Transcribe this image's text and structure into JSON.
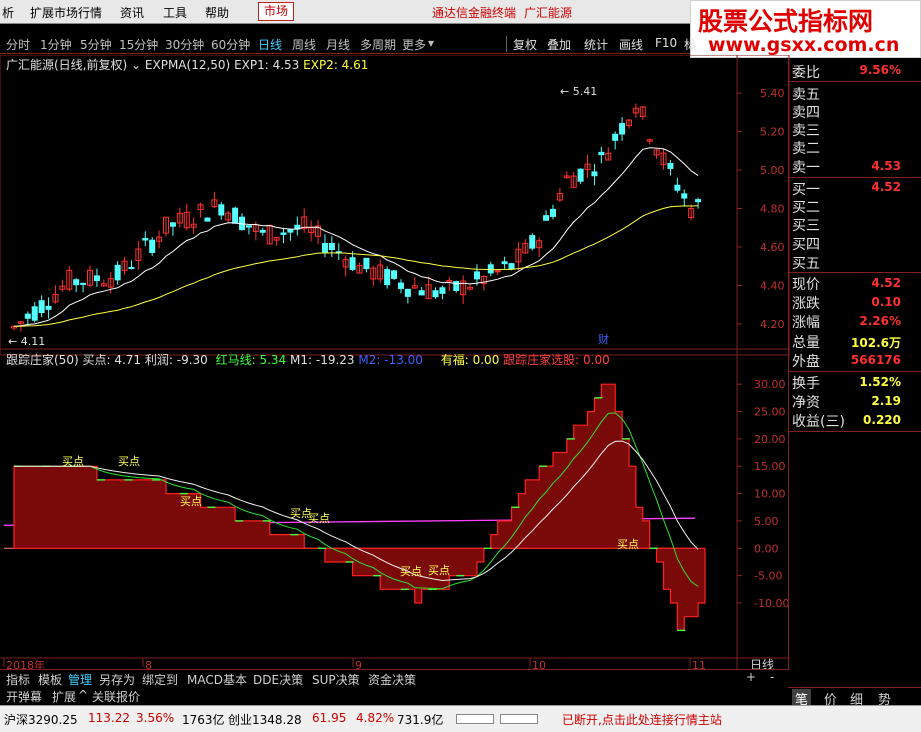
{
  "menubar": {
    "items": [
      "析",
      "扩展市场行情",
      "资讯",
      "工具",
      "帮助"
    ],
    "market": "市场",
    "center_title": "通达信金融终端",
    "stock_title": "广汇能源"
  },
  "logo": {
    "main": "股票公式指标网",
    "url": "www.gsxx.com.cn"
  },
  "periods": [
    "分时",
    "1分钟",
    "5分钟",
    "15分钟",
    "30分钟",
    "60分钟",
    "日线",
    "周线",
    "月线",
    "多周期",
    "更多"
  ],
  "active_period": "日线",
  "tools": [
    "复权",
    "叠加",
    "统计",
    "画线",
    "F10",
    "标"
  ],
  "main_legend": {
    "stock": "广汇能源(日线,前复权)",
    "indicator": "EXPMA(12,50)",
    "exp1": "EXP1: 4.53",
    "exp2": "EXP2: 4.61"
  },
  "sub_legend": {
    "name": "跟踪庄家(50)",
    "buy": "买点: 4.71",
    "profit": "利润: -9.30",
    "red": "红马线: 5.34",
    "m1": "M1: -19.23",
    "m2": "M2: -13.00",
    "youfu": "有福: 0.00",
    "select": "跟踪庄家选股: 0.00"
  },
  "price_axis": [
    "5.40",
    "5.20",
    "5.00",
    "4.80",
    "4.60",
    "4.40",
    "4.20"
  ],
  "sub_axis": [
    "30.00",
    "25.00",
    "20.00",
    "15.00",
    "10.00",
    "5.00",
    "0.00",
    "-5.00",
    "-10.00"
  ],
  "annotations": {
    "high": "5.41",
    "low": "4.11",
    "cai": "财",
    "buy_labels": [
      "买点",
      "买点",
      "买点",
      "买点",
      "买点",
      "买点",
      "买点",
      "买点"
    ]
  },
  "date_axis": [
    "2018年",
    "8",
    "9",
    "10",
    "11"
  ],
  "date_period": "日线",
  "right_panel": {
    "weibi_label": "委比",
    "weibi": "9.56%",
    "sell": [
      "卖五",
      "卖四",
      "卖三",
      "卖二",
      "卖一"
    ],
    "sell1_price": "4.53",
    "buy": [
      "买一",
      "买二",
      "买三",
      "买四",
      "买五"
    ],
    "buy1_price": "4.52",
    "stats": [
      {
        "label": "现价",
        "value": "4.52",
        "color": "#ff3030"
      },
      {
        "label": "涨跌",
        "value": "0.10",
        "color": "#ff3030"
      },
      {
        "label": "涨幅",
        "value": "2.26%",
        "color": "#ff3030"
      },
      {
        "label": "总量",
        "value": "102.6万",
        "color": "#ffff40"
      },
      {
        "label": "外盘",
        "value": "566176",
        "color": "#ff3030"
      },
      {
        "label": "换手",
        "value": "1.52%",
        "color": "#ffff40"
      },
      {
        "label": "净资",
        "value": "2.19",
        "color": "#ffff40"
      },
      {
        "label": "收益(三)",
        "value": "0.220",
        "color": "#ffff40"
      }
    ],
    "tabs": [
      "笔",
      "价",
      "细",
      "势"
    ]
  },
  "bottom_tabs": [
    "指标",
    "模板",
    "管理",
    "另存为",
    "绑定到",
    "MACD基本",
    "DDE决策",
    "SUP决策",
    "资金决策"
  ],
  "bottom_tools": [
    "开弹幕",
    "扩展",
    "关联报价"
  ],
  "statusbar": {
    "index1": "沪深3290.25",
    "index1_chg": "113.22",
    "index1_pct": "3.56%",
    "index1_amt": "1763亿",
    "index2": "创业1348.28",
    "index2_chg": "61.95",
    "index2_pct": "4.82%",
    "index2_amt": "731.9亿",
    "msg": "已断开,点击此处连接行情主站"
  },
  "chart_data": {
    "type": "candlestick",
    "price_ylim": [
      4.08,
      5.52
    ],
    "sub_ylim": [
      -19.5,
      33.5
    ]
  }
}
